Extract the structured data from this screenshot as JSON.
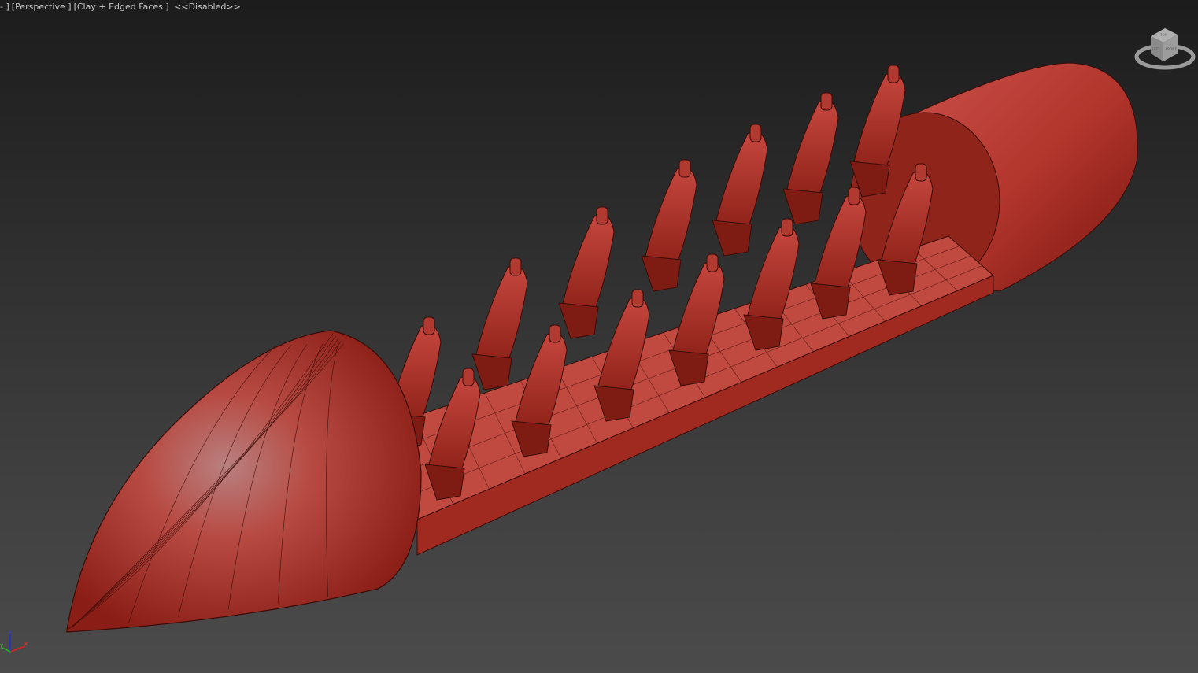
{
  "viewport": {
    "menu_label": "-",
    "view_label": "Perspective",
    "shading_label": "Clay + Edged Faces",
    "status_label": "<<Disabled>>"
  },
  "viewcube": {
    "faces": [
      "TOP",
      "FRONT",
      "LEFT"
    ]
  },
  "axis_gizmo": {
    "x": "x",
    "y": "y",
    "z": "z"
  },
  "colors": {
    "model": "#b8352c",
    "edge": "#3a0c08",
    "background_top": "#1c1c1c",
    "background_bottom": "#4b4b4b"
  }
}
